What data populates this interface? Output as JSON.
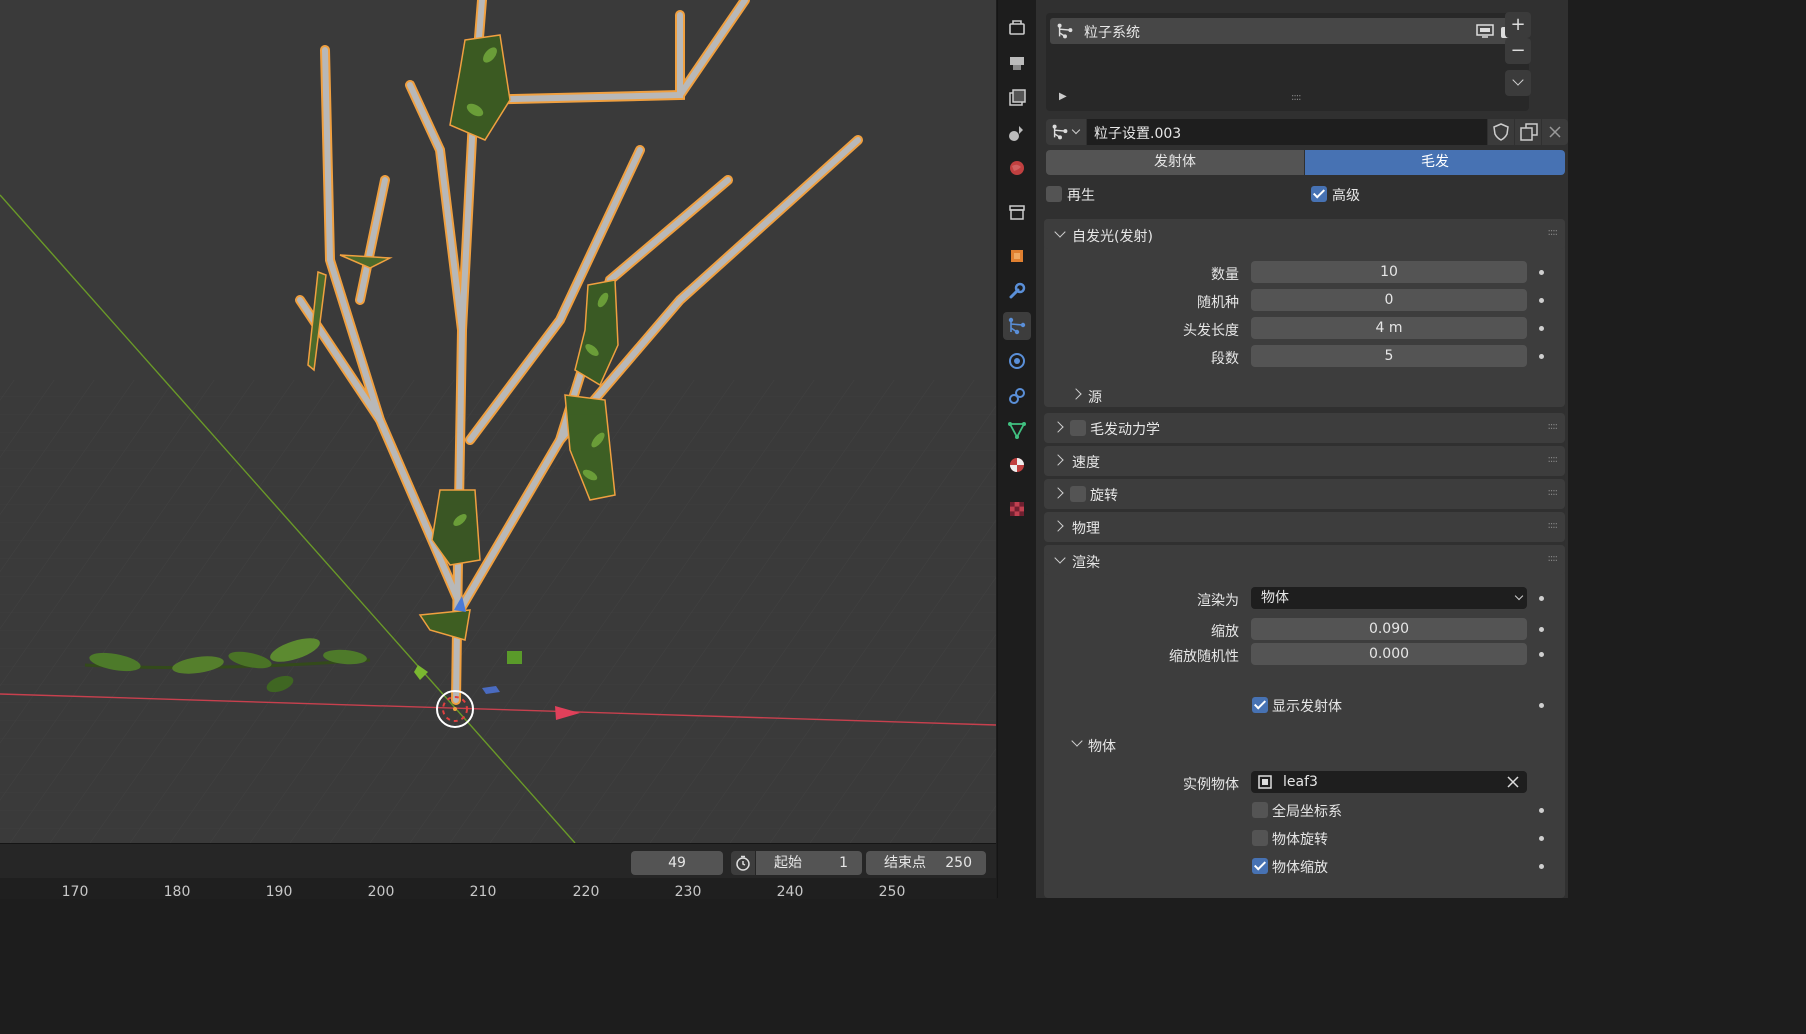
{
  "particle_list": {
    "item_label": "粒子系统"
  },
  "settings": {
    "name": "粒子设置.003"
  },
  "type_tabs": {
    "emitter": "发射体",
    "hair": "毛发"
  },
  "options": {
    "regrow_label": "再生",
    "regrow_checked": false,
    "advanced_label": "高级",
    "advanced_checked": true
  },
  "emission": {
    "title": "自发光(发射)",
    "number_label": "数量",
    "number_value": "10",
    "seed_label": "随机种",
    "seed_value": "0",
    "hair_length_label": "头发长度",
    "hair_length_value": "4 m",
    "segments_label": "段数",
    "segments_value": "5",
    "source_label": "源"
  },
  "panels": {
    "hair_dynamics": "毛发动力学",
    "velocity": "速度",
    "rotation": "旋转",
    "physics": "物理",
    "render": "渲染"
  },
  "render": {
    "render_as_label": "渲染为",
    "render_as_value": "物体",
    "scale_label": "缩放",
    "scale_value": "0.090",
    "scale_random_label": "缩放随机性",
    "scale_random_value": "0.000",
    "show_emitter_label": "显示发射体",
    "show_emitter_checked": true
  },
  "object": {
    "title": "物体",
    "instance_label": "实例物体",
    "instance_value": "leaf3",
    "global_coords_label": "全局坐标系",
    "object_rotation_label": "物体旋转",
    "object_scale_label": "物体缩放"
  },
  "timeline": {
    "current_frame": "49",
    "start_label": "起始",
    "start_value": "1",
    "end_label": "结束点",
    "end_value": "250",
    "ticks": [
      "170",
      "180",
      "190",
      "200",
      "210",
      "220",
      "230",
      "240",
      "250"
    ]
  },
  "colors": {
    "accent": "#4772b3",
    "selection": "#f0a040",
    "x_axis": "#c8404e",
    "y_axis": "#6a9a28"
  }
}
